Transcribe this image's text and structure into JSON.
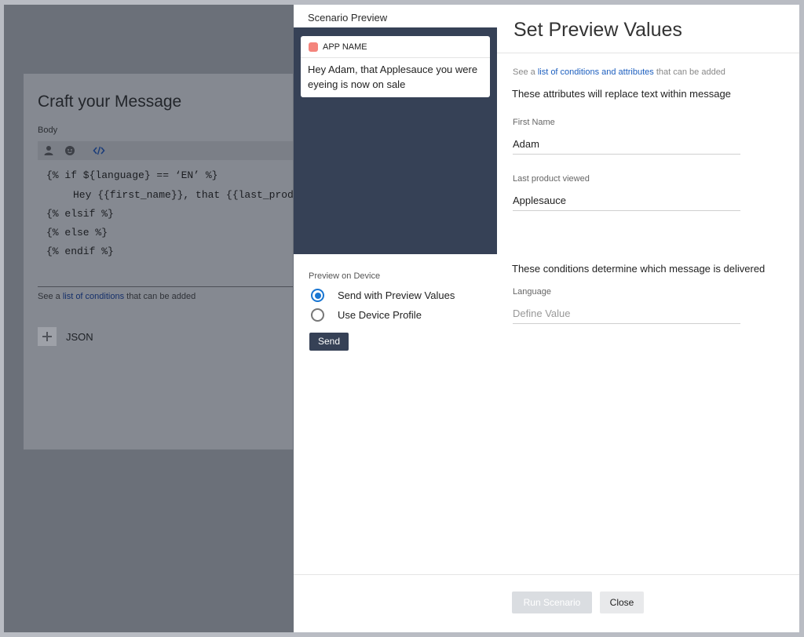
{
  "composer": {
    "title": "Craft your Message",
    "body_label": "Body",
    "toolbar_icons": [
      "user-icon",
      "emoji-icon",
      "code-icon"
    ],
    "code_lines": [
      "{% if ${language} == ‘EN’ %}",
      "Hey {{first_name}}, that {{last_product_viewed}}",
      "{% elsif %}",
      "{% else %}",
      "{% endif %}"
    ],
    "hint_prefix": "See a ",
    "hint_link": "list of conditions",
    "hint_suffix": " that can be added",
    "json_label": "JSON"
  },
  "preview": {
    "title": "Scenario Preview",
    "notification": {
      "app_name": "APP NAME",
      "message": "Hey Adam, that Applesauce you were eyeing is now on sale"
    },
    "preview_on_device_label": "Preview on Device",
    "options": [
      {
        "label": "Send with Preview Values",
        "selected": true
      },
      {
        "label": "Use Device Profile",
        "selected": false
      }
    ],
    "send_label": "Send"
  },
  "values_panel": {
    "title": "Set Preview Values",
    "hint_prefix": "See a ",
    "hint_link": "list of conditions and attributes",
    "hint_suffix": " that can be added",
    "attributes_title": "These attributes will replace text within message",
    "fields": [
      {
        "label": "First Name",
        "value": "Adam",
        "placeholder": ""
      },
      {
        "label": "Last product viewed",
        "value": "Applesauce",
        "placeholder": ""
      }
    ],
    "conditions_title": "These conditions determine which message is delivered",
    "condition_fields": [
      {
        "label": "Language",
        "value": "",
        "placeholder": "Define Value"
      }
    ],
    "run_label": "Run Scenario",
    "close_label": "Close"
  },
  "colors": {
    "accent": "#1976d2",
    "navy": "#364156",
    "app_icon": "#f4847c",
    "link": "#1d5fbf"
  }
}
